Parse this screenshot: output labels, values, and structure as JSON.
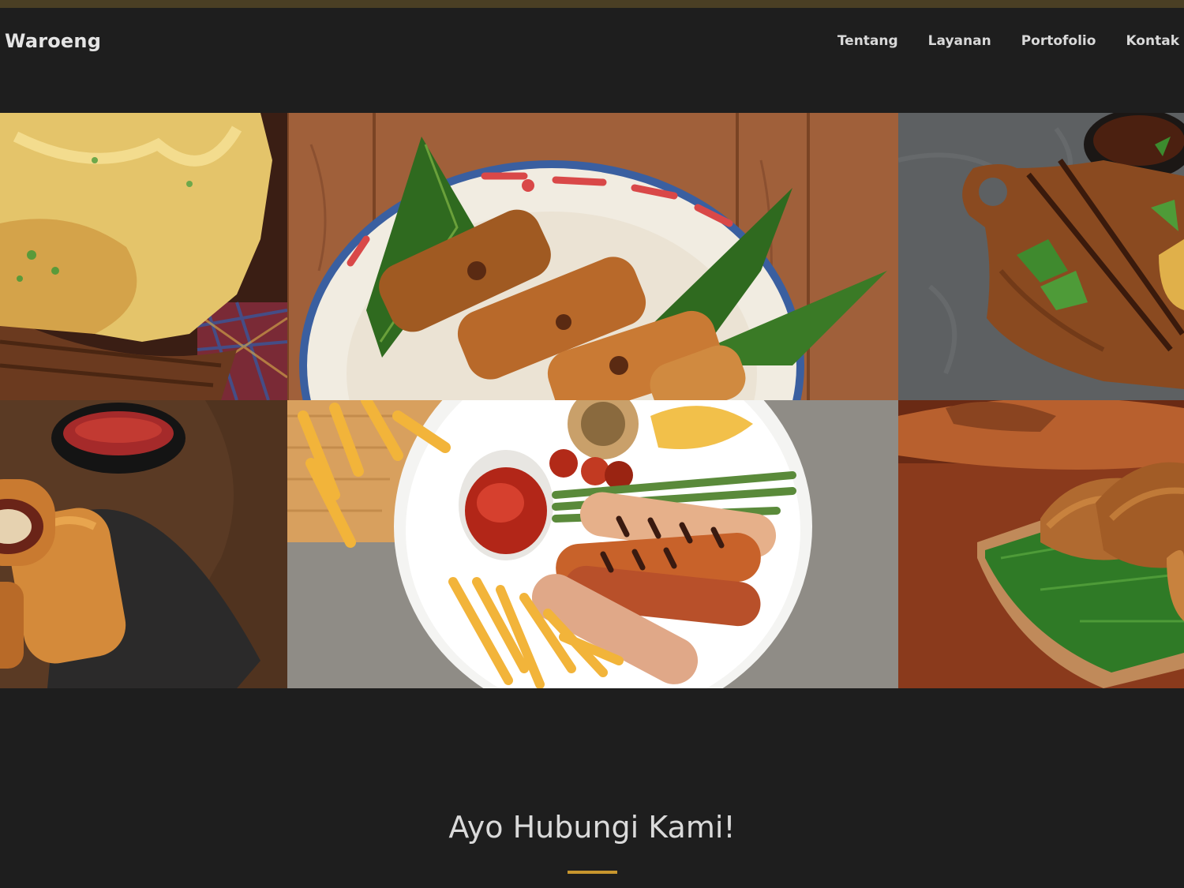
{
  "brand": "Waroeng",
  "nav": {
    "items": [
      "Tentang",
      "Layanan",
      "Portofolio",
      "Kontak"
    ]
  },
  "gallery": {
    "tiles": [
      {
        "name": "portfolio-item-tahu-walik"
      },
      {
        "name": "portfolio-item-lumpia"
      },
      {
        "name": "portfolio-item-cutting-board"
      },
      {
        "name": "portfolio-item-risoles"
      },
      {
        "name": "portfolio-item-sausage-platter"
      },
      {
        "name": "portfolio-item-pangsit"
      }
    ]
  },
  "contact": {
    "title": "Ayo Hubungi Kami!"
  },
  "colors": {
    "background": "#1e1e1e",
    "topbar": "#4a3f24",
    "accent": "#c8962e",
    "text": "#dadada"
  }
}
